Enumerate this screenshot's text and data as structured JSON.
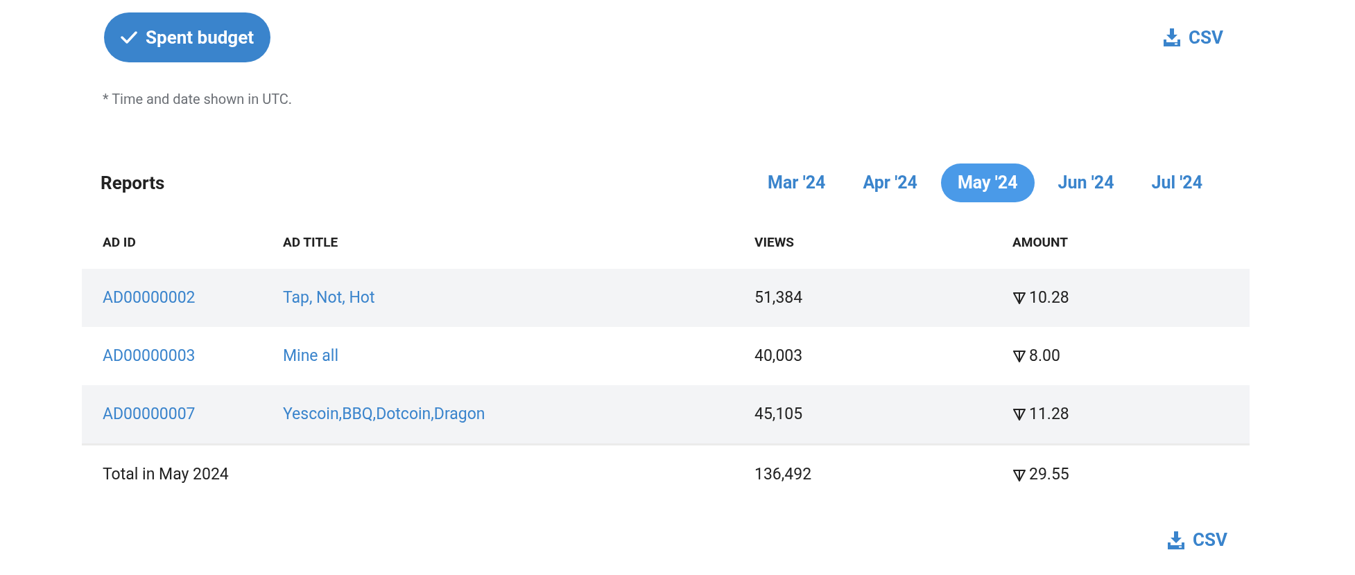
{
  "filter": {
    "label": "Spent budget",
    "selected": true
  },
  "csv_top": {
    "label": "CSV"
  },
  "note": "* Time and date shown in UTC.",
  "reports": {
    "title": "Reports",
    "tabs": [
      {
        "label": "Mar '24",
        "selected": false
      },
      {
        "label": "Apr '24",
        "selected": false
      },
      {
        "label": "May '24",
        "selected": true
      },
      {
        "label": "Jun '24",
        "selected": false
      },
      {
        "label": "Jul '24",
        "selected": false
      }
    ]
  },
  "table": {
    "columns": [
      "AD ID",
      "AD TITLE",
      "VIEWS",
      "AMOUNT"
    ],
    "rows": [
      {
        "ad_id": "AD00000002",
        "ad_title": "Tap, Not, Hot",
        "views": "51,384",
        "amount": "10.28"
      },
      {
        "ad_id": "AD00000003",
        "ad_title": "Mine all",
        "views": "40,003",
        "amount": "8.00"
      },
      {
        "ad_id": "AD00000007",
        "ad_title": "Yescoin,BBQ,Dotcoin,Dragon",
        "views": "45,105",
        "amount": "11.28"
      }
    ],
    "total": {
      "label": "Total in May 2024",
      "views": "136,492",
      "amount": "29.55"
    }
  },
  "csv_bottom": {
    "label": "CSV"
  }
}
